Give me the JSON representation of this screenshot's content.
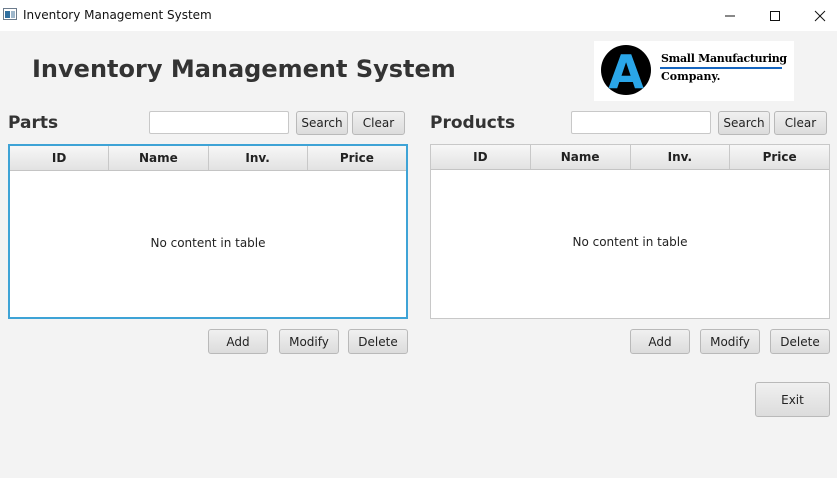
{
  "window": {
    "title": "Inventory Management System"
  },
  "heading": "Inventory Management System",
  "logo": {
    "letter": "A",
    "line1": "Small Manufacturing",
    "line2": "Company."
  },
  "parts": {
    "title": "Parts",
    "search_value": "",
    "search_label": "Search",
    "clear_label": "Clear",
    "columns": [
      "ID",
      "Name",
      "Inv.",
      "Price"
    ],
    "empty_text": "No content in table",
    "add_label": "Add",
    "modify_label": "Modify",
    "delete_label": "Delete"
  },
  "products": {
    "title": "Products",
    "search_value": "",
    "search_label": "Search",
    "clear_label": "Clear",
    "columns": [
      "ID",
      "Name",
      "Inv.",
      "Price"
    ],
    "empty_text": "No content in table",
    "add_label": "Add",
    "modify_label": "Modify",
    "delete_label": "Delete"
  },
  "exit_label": "Exit"
}
